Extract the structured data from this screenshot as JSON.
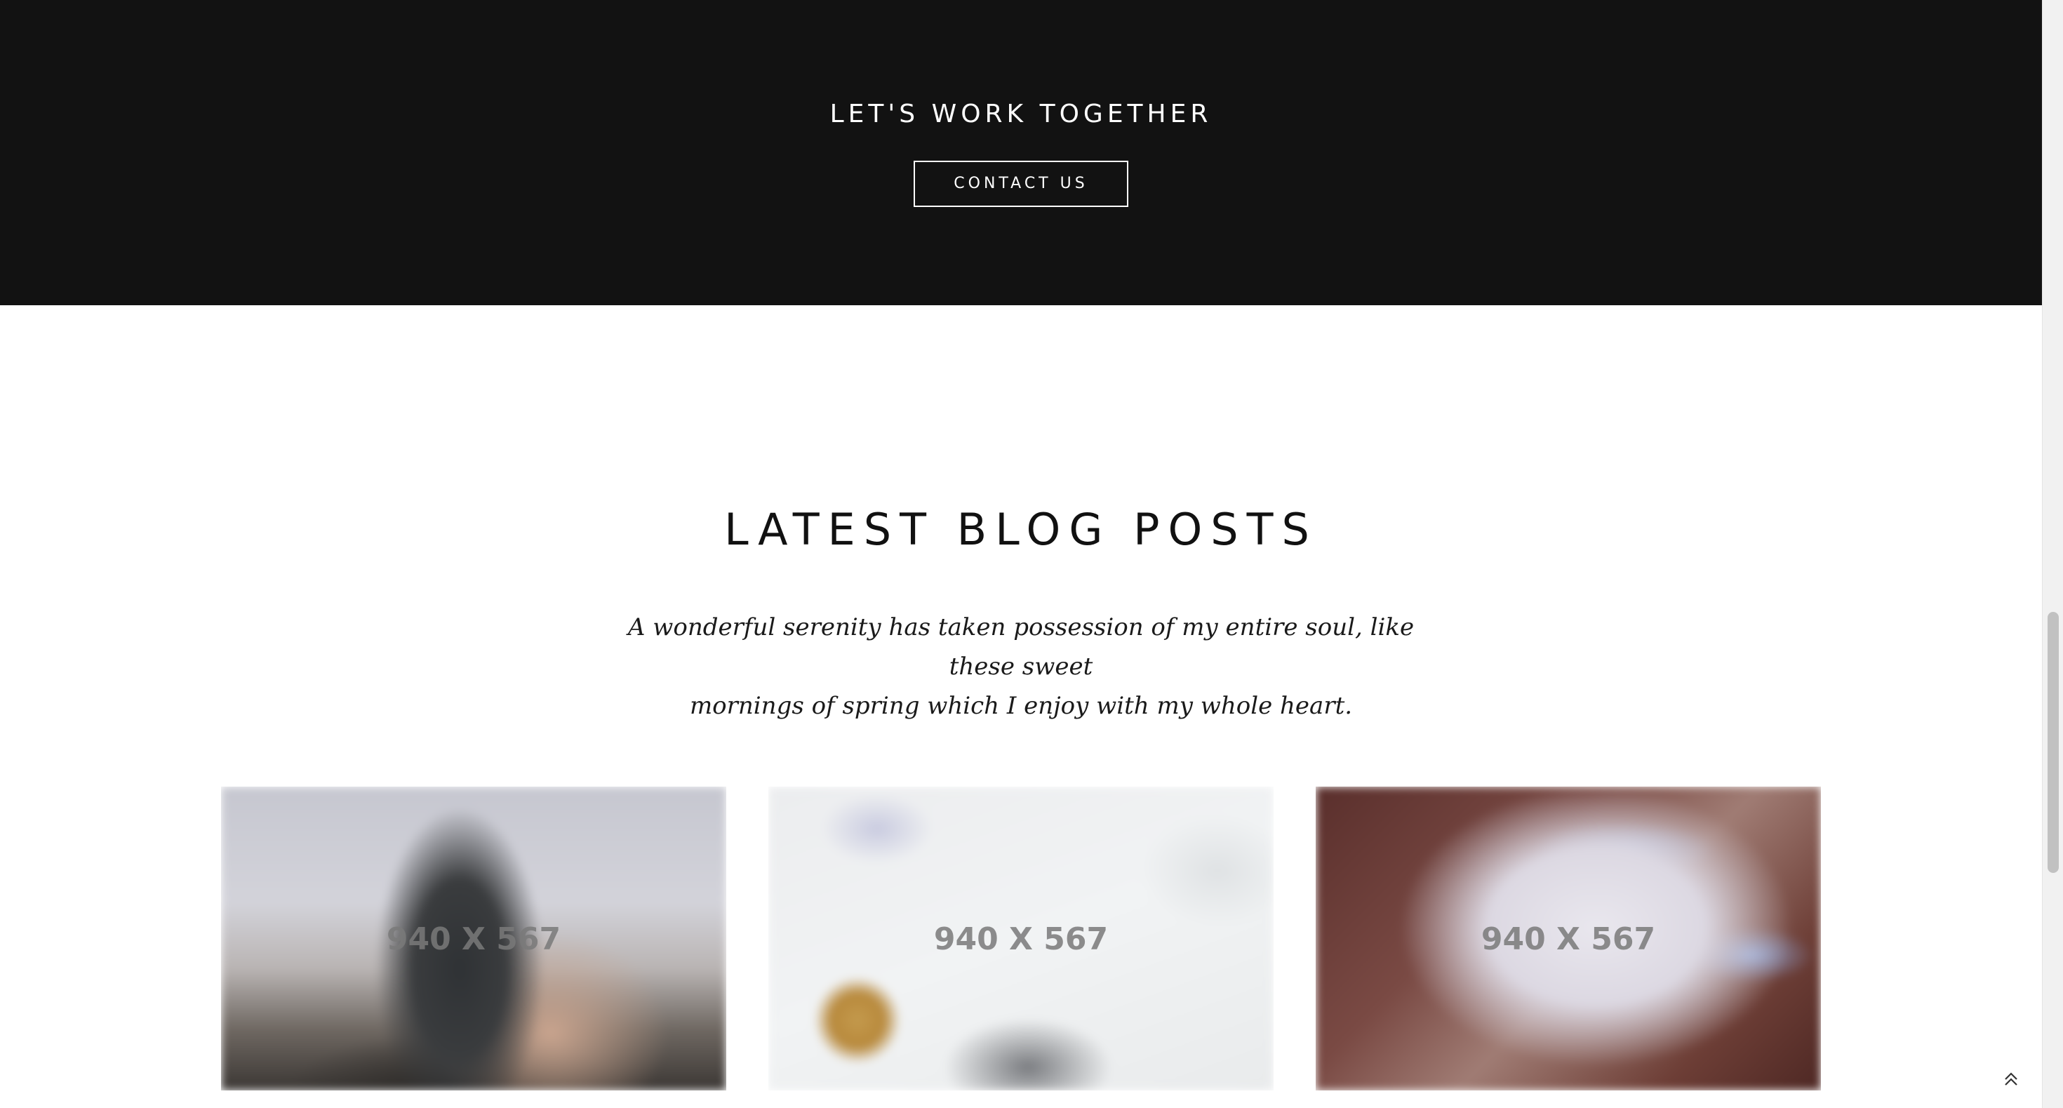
{
  "cta": {
    "title": "LET'S WORK TOGETHER",
    "button_label": "CONTACT US"
  },
  "blog": {
    "title": "LATEST BLOG POSTS",
    "subtitle_line1": "A wonderful serenity has taken possession of my entire soul, like these sweet",
    "subtitle_line2": "mornings of spring which I enjoy with my whole heart.",
    "posts": [
      {
        "image_label": "940 X 567"
      },
      {
        "image_label": "940 X 567"
      },
      {
        "image_label": "940 X 567"
      }
    ]
  },
  "colors": {
    "cta_background": "#121212",
    "page_background": "#ffffff",
    "text_dark": "#111111"
  },
  "icons": {
    "back_to_top": "double-chevron-up-icon"
  }
}
